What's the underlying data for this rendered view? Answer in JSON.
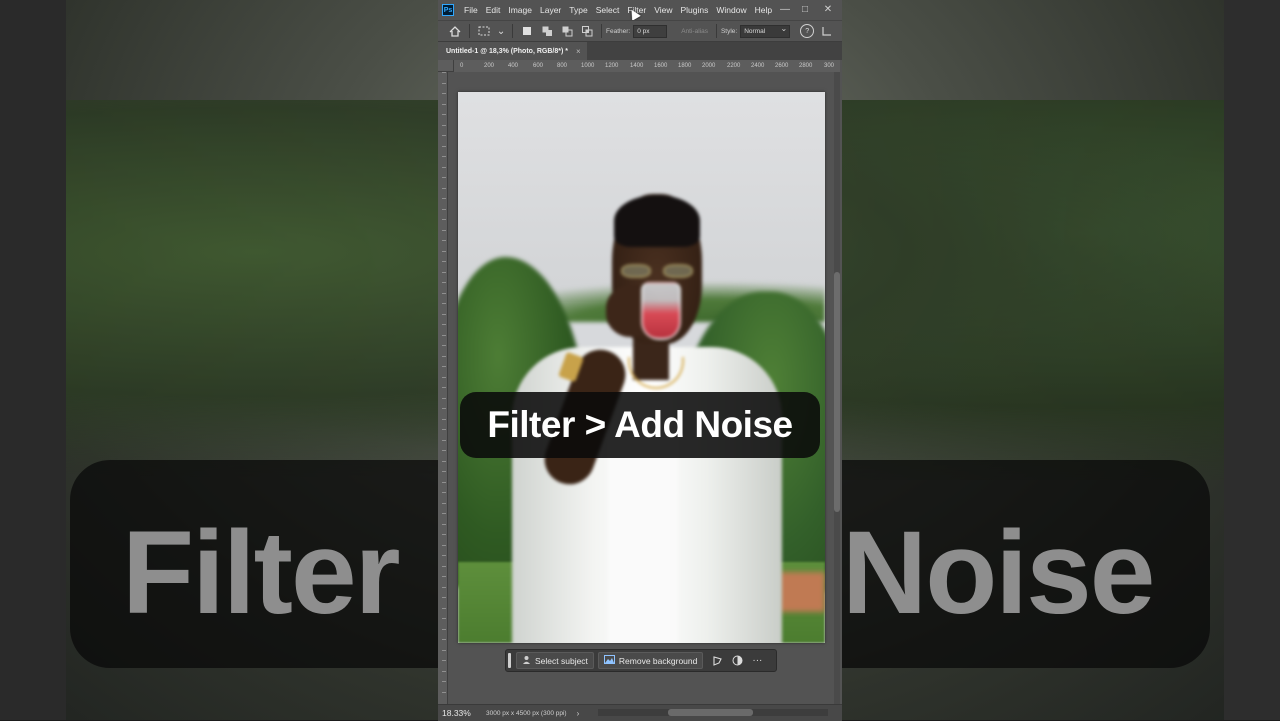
{
  "background": {
    "ghost_caption_left": "Filter",
    "ghost_caption_right": "Noise"
  },
  "app": {
    "logo": "Ps",
    "menu": [
      "File",
      "Edit",
      "Image",
      "Layer",
      "Type",
      "Select",
      "Filter",
      "View",
      "Plugins",
      "Window",
      "Help"
    ],
    "window_controls": {
      "minimize": "—",
      "maximize": "□",
      "close": "✕"
    }
  },
  "options_bar": {
    "feather_label": "Feather:",
    "feather_value": "0 px",
    "anti_alias_label": "Anti-alias",
    "style_label": "Style:",
    "style_value": "Normal",
    "help_icon": "?"
  },
  "document": {
    "tab_title": "Untitled-1 @ 18,3% (Photo, RGB/8*) *",
    "tab_close": "×"
  },
  "ruler": {
    "top_ticks": [
      "0",
      "200",
      "400",
      "600",
      "800",
      "1000",
      "1200",
      "1400",
      "1600",
      "1800",
      "2000",
      "2200",
      "2400",
      "2600",
      "2800",
      "300"
    ]
  },
  "caption": {
    "text": "Filter > Add Noise"
  },
  "contextual_taskbar": {
    "select_subject": "Select subject",
    "remove_background": "Remove background",
    "more": "···"
  },
  "status_bar": {
    "zoom": "18.33%",
    "doc_info": "3000 px x 4500 px (300 ppi)",
    "arrow": "›"
  },
  "colors": {
    "ui_panel": "#535353",
    "ps_blue": "#31a8ff",
    "caption_bg": "#0a0a0a"
  }
}
